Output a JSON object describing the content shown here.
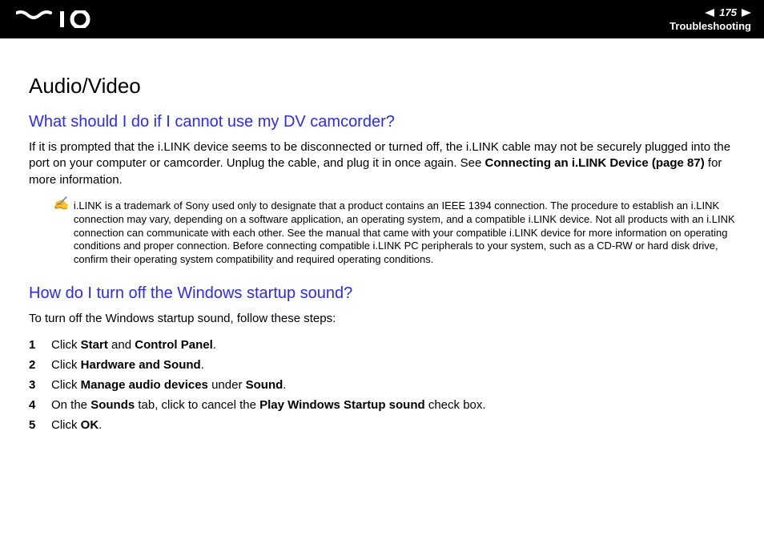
{
  "header": {
    "page_number": "175",
    "section": "Troubleshooting"
  },
  "main": {
    "title": "Audio/Video",
    "q1": {
      "heading": "What should I do if I cannot use my DV camcorder?",
      "para_pre": "If it is prompted that the i.LINK device seems to be disconnected or turned off, the i.LINK cable may not be securely plugged into the port on your computer or camcorder. Unplug the cable, and plug it in once again. See ",
      "para_bold": "Connecting an i.LINK Device (page 87)",
      "para_post": " for more information.",
      "note_icon": "✍",
      "note": "i.LINK is a trademark of Sony used only to designate that a product contains an IEEE 1394 connection. The procedure to establish an i.LINK connection may vary, depending on a software application, an operating system, and a compatible i.LINK device. Not all products with an i.LINK connection can communicate with each other. See the manual that came with your compatible i.LINK device for more information on operating conditions and proper connection. Before connecting compatible i.LINK PC peripherals to your system, such as a CD-RW or hard disk drive, confirm their operating system compatibility and required operating conditions."
    },
    "q2": {
      "heading": "How do I turn off the Windows startup sound?",
      "intro": "To turn off the Windows startup sound, follow these steps:",
      "steps": {
        "s1_a": "Click ",
        "s1_b": "Start",
        "s1_c": " and ",
        "s1_d": "Control Panel",
        "s1_e": ".",
        "s2_a": "Click ",
        "s2_b": "Hardware and Sound",
        "s2_c": ".",
        "s3_a": "Click ",
        "s3_b": "Manage audio devices",
        "s3_c": " under ",
        "s3_d": "Sound",
        "s3_e": ".",
        "s4_a": "On the ",
        "s4_b": "Sounds",
        "s4_c": " tab, click to cancel the ",
        "s4_d": "Play Windows Startup sound",
        "s4_e": " check box.",
        "s5_a": "Click ",
        "s5_b": "OK",
        "s5_c": "."
      }
    }
  }
}
